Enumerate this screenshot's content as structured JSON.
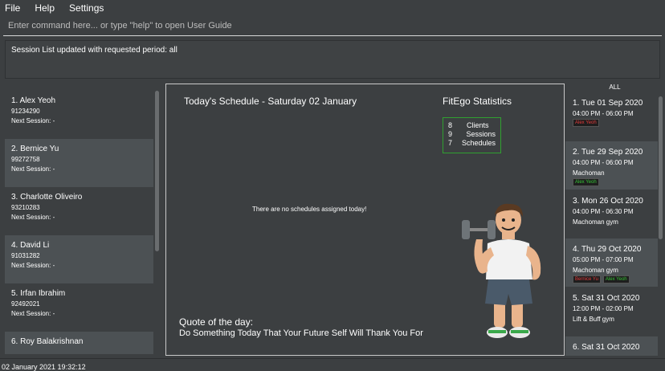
{
  "menu": {
    "file": "File",
    "help": "Help",
    "settings": "Settings"
  },
  "command": {
    "placeholder": "Enter command here... or type \"help\" to open User Guide",
    "value": ""
  },
  "result": {
    "text": "Session List updated with requested period: all"
  },
  "clients": [
    {
      "name": "1.  Alex Yeoh",
      "phone": "91234290",
      "next": "Next Session: -"
    },
    {
      "name": "2.  Bernice Yu",
      "phone": "99272758",
      "next": "Next Session: -"
    },
    {
      "name": "3.  Charlotte Oliveiro",
      "phone": "93210283",
      "next": "Next Session: -"
    },
    {
      "name": "4.  David Li",
      "phone": "91031282",
      "next": "Next Session: -"
    },
    {
      "name": "5.  Irfan Ibrahim",
      "phone": "92492021",
      "next": "Next Session: -"
    },
    {
      "name": "6.  Roy Balakrishnan",
      "phone": "",
      "next": ""
    }
  ],
  "schedule": {
    "title": "Today's Schedule - Saturday 02 January",
    "empty": "There are no schedules assigned today!"
  },
  "stats": {
    "title": "FitEgo Statistics",
    "rows": [
      {
        "num": "8",
        "label": "Clients"
      },
      {
        "num": "9",
        "label": "Sessions"
      },
      {
        "num": "7",
        "label": "Schedules"
      }
    ]
  },
  "quote": {
    "label": "Quote of the day:",
    "text": "Do Something Today That Your Future Self Will Thank You For"
  },
  "sessions": {
    "period_label": "ALL",
    "items": [
      {
        "date": "1.  Tue 01 Sep 2020",
        "time": "04:00 PM - 06:00 PM",
        "gym": "Machoman",
        "tags": [
          {
            "text": "Alex Yeoh",
            "color": "red"
          }
        ]
      },
      {
        "date": "2.  Tue 29 Sep 2020",
        "time": "04:00 PM - 06:00 PM",
        "gym": "Machoman",
        "tags": [
          {
            "text": "Alex Yeoh",
            "color": "green"
          }
        ]
      },
      {
        "date": "3.  Mon 26 Oct 2020",
        "time": "04:00 PM - 06:30 PM",
        "gym": "Machoman gym",
        "tags": []
      },
      {
        "date": "4.  Thu 29 Oct 2020",
        "time": "05:00 PM - 07:00 PM",
        "gym": "Machoman gym",
        "tags": [
          {
            "text": "Bernice Yu",
            "color": "red"
          },
          {
            "text": "Alex Yeoh",
            "color": "green"
          }
        ]
      },
      {
        "date": "5.  Sat 31 Oct 2020",
        "time": "12:00 PM - 02:00 PM",
        "gym": "Lift & Buff gym",
        "tags": []
      },
      {
        "date": "6.  Sat 31 Oct 2020",
        "time": "",
        "gym": "",
        "tags": []
      }
    ]
  },
  "status": {
    "datetime": "02 January 2021 19:32:12"
  },
  "colors": {
    "background": "#3c3f41",
    "card_alt": "#4c5154",
    "stats_border": "#30a030",
    "tag_red": "#e23a3a",
    "tag_green": "#35c235"
  },
  "icons": {
    "mascot": "bodybuilder-dumbbell-illustration"
  }
}
